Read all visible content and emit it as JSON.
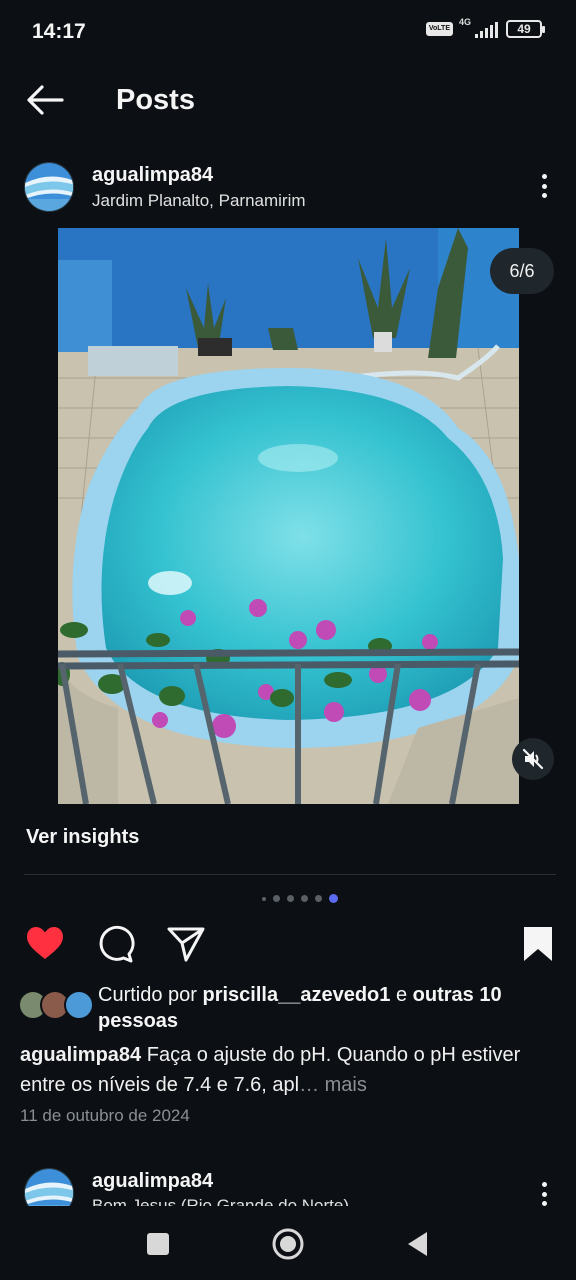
{
  "status_bar": {
    "time": "14:17",
    "network": "4G",
    "volte": "VoLTE",
    "battery": "49"
  },
  "header": {
    "title": "Posts",
    "back_icon": "arrow-left-icon"
  },
  "post": {
    "username": "agualimpa84",
    "location": "Jardim Planalto, Parnamirim",
    "media_counter": "6/6",
    "insights_label": "Ver insights",
    "carousel": {
      "total": 6,
      "active_index": 6
    },
    "liked": true,
    "likes": {
      "prefix": "Curtido por ",
      "user": "priscilla__azevedo1",
      "connector": " e ",
      "others": "outras 10 pessoas"
    },
    "caption": {
      "username": "agualimpa84",
      "text": " Faça o ajuste do pH. Quando o pH estiver entre os níveis de 7.4 e 7.6, apl",
      "ellipsis": "… ",
      "more": "mais"
    },
    "date": "11 de outubro de 2024"
  },
  "next_post": {
    "username": "agualimpa84",
    "location": "Bom Jesus (Rio Grande do Norte)"
  },
  "colors": {
    "background": "#0c1014",
    "like_red": "#ff3040",
    "carousel_active": "#5b6cf0",
    "muted_text": "#8a8f94"
  }
}
